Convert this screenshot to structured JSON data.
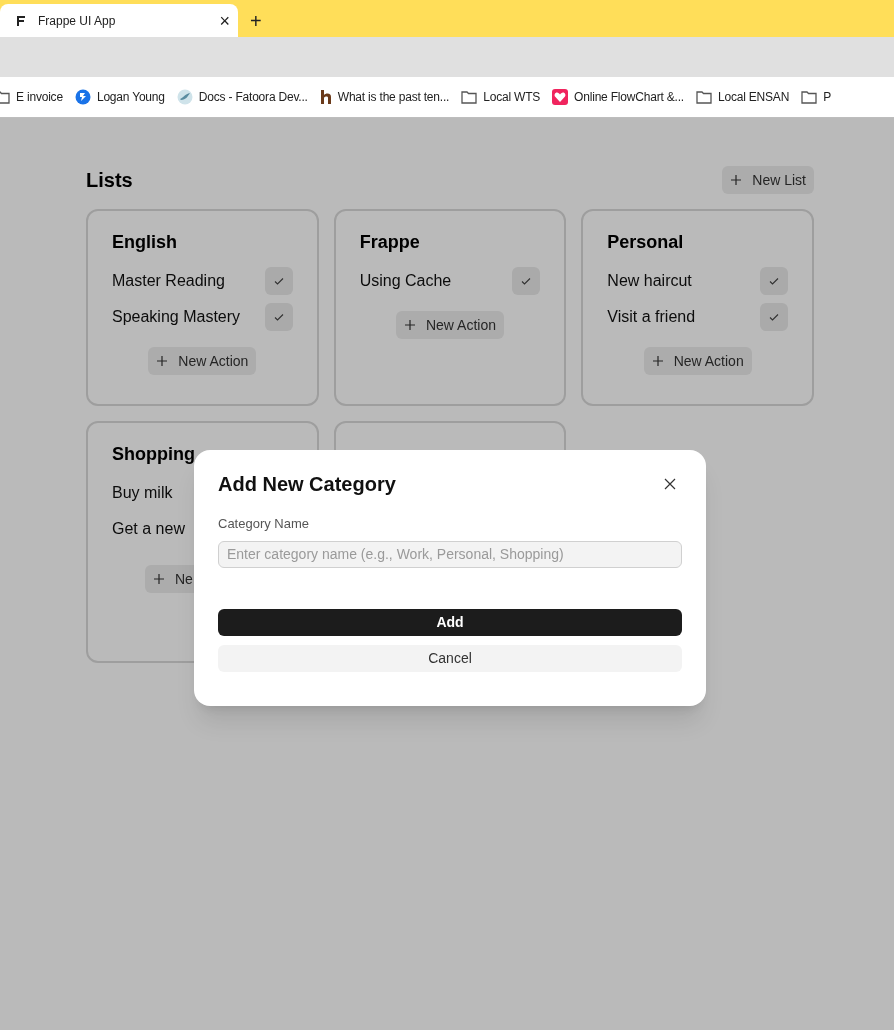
{
  "browser": {
    "tab": {
      "title": "Frappe UI App",
      "close": "×"
    },
    "new_tab": "+",
    "bookmarks": [
      {
        "label": "E invoice",
        "kind": "folder"
      },
      {
        "label": "Logan Young",
        "kind": "globe"
      },
      {
        "label": "Docs - Fatoora Dev...",
        "kind": "bird"
      },
      {
        "label": "What is the past ten...",
        "kind": "letter"
      },
      {
        "label": "Local WTS",
        "kind": "folder"
      },
      {
        "label": "Online FlowChart &...",
        "kind": "heart"
      },
      {
        "label": "Local ENSAN",
        "kind": "folder"
      },
      {
        "label": "P",
        "kind": "folder"
      }
    ]
  },
  "page": {
    "title": "Lists",
    "new_list_button": "New List",
    "lists": [
      {
        "kind": "card",
        "title": "English",
        "actions": [
          "Master Reading",
          "Speaking Mastery"
        ],
        "new_action": "New Action"
      },
      {
        "kind": "card",
        "title": "Frappe",
        "actions": [
          "Using Cache"
        ],
        "new_action": "New Action"
      },
      {
        "kind": "card",
        "title": "Personal",
        "actions": [
          "New haircut",
          "Visit a friend"
        ],
        "new_action": "New Action"
      },
      {
        "kind": "half-covered-card",
        "title": "Shopping",
        "actions": [
          "Buy milk",
          "Get a new"
        ],
        "new_action": "Ne"
      },
      {
        "kind": "covered-card"
      }
    ]
  },
  "dialog": {
    "title": "Add New Category",
    "field_label": "Category Name",
    "placeholder": "Enter category name (e.g., Work, Personal, Shopping)",
    "add_button": "Add",
    "cancel_button": "Cancel"
  }
}
